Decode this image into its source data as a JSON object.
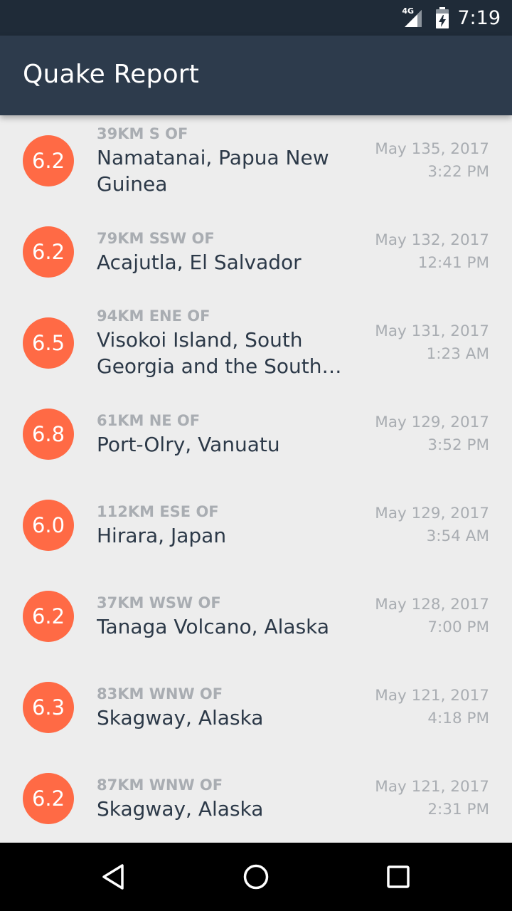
{
  "status_bar": {
    "network": "4G",
    "time": "7:19"
  },
  "app_bar": {
    "title": "Quake Report"
  },
  "earthquakes": [
    {
      "magnitude": "6.2",
      "offset": "39km S of",
      "location": "Namatanai, Papua New Guinea",
      "date": "May 135, 2017",
      "time": "3:22 PM"
    },
    {
      "magnitude": "6.2",
      "offset": "79km SSW of",
      "location": "Acajutla, El Salvador",
      "date": "May 132, 2017",
      "time": "12:41 PM"
    },
    {
      "magnitude": "6.5",
      "offset": "94km ENE of",
      "location": "Visokoi Island, South Georgia and the South Sandwich Islands",
      "date": "May 131, 2017",
      "time": "1:23 AM"
    },
    {
      "magnitude": "6.8",
      "offset": "61km NE of",
      "location": "Port-Olry, Vanuatu",
      "date": "May 129, 2017",
      "time": "3:52 PM"
    },
    {
      "magnitude": "6.0",
      "offset": "112km ESE of",
      "location": "Hirara, Japan",
      "date": "May 129, 2017",
      "time": "3:54 AM"
    },
    {
      "magnitude": "6.2",
      "offset": "37km WSW of",
      "location": "Tanaga Volcano, Alaska",
      "date": "May 128, 2017",
      "time": "7:00 PM"
    },
    {
      "magnitude": "6.3",
      "offset": "83km WNW of",
      "location": "Skagway, Alaska",
      "date": "May 121, 2017",
      "time": "4:18 PM"
    },
    {
      "magnitude": "6.2",
      "offset": "87km WNW of",
      "location": "Skagway, Alaska",
      "date": "May 121, 2017",
      "time": "2:31 PM"
    }
  ],
  "nav": {
    "back_icon": "triangle-back-icon",
    "home_icon": "circle-home-icon",
    "recents_icon": "square-recents-icon"
  },
  "colors": {
    "status_bar": "#1f2b38",
    "app_bar": "#2d3b4c",
    "magnitude_circle": "#ff6a45",
    "background": "#ededed",
    "primary_text": "#2c3948",
    "secondary_text": "#a9adb2"
  }
}
